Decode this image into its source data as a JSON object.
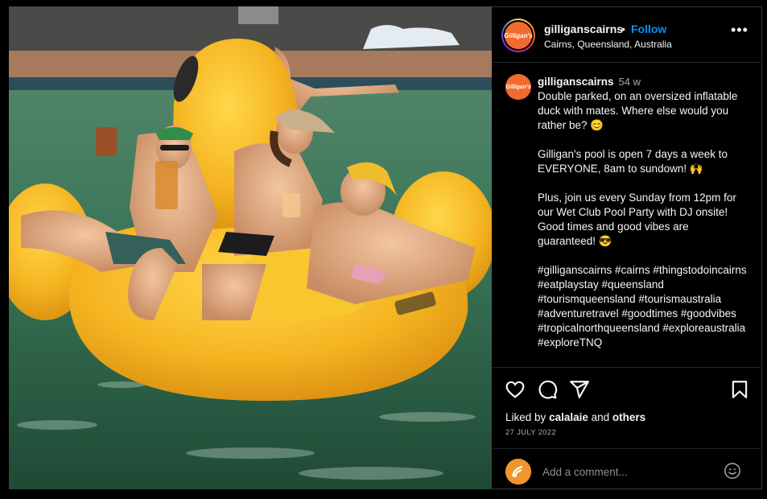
{
  "post": {
    "username": "gilliganscairns",
    "separator": "•",
    "follow_label": "Follow",
    "location": "Cairns, Queensland, Australia",
    "more_label": "•••",
    "avatar_text": "Gilligan's"
  },
  "caption": {
    "username": "gilliganscairns",
    "time_ago": "54 w",
    "text": "Double parked, on an oversized inflatable duck with mates. Where else would you rather be? 😊\n\nGilligan's pool is open 7 days a week to EVERYONE, 8am to sundown! 🙌\n\nPlus, join us every Sunday from 12pm for our Wet Club Pool Party with DJ onsite! Good times and good vibes are guaranteed! 😎\n\n#gilliganscairns #cairns #thingstodoincairns #eatplaystay #queensland #tourismqueensland #tourismaustralia #adventuretravel #goodtimes #goodvibes #tropicalnorthqueensland #exploreaustralia #exploreTNQ"
  },
  "actions": {
    "like_icon": "heart-icon",
    "comment_icon": "comment-icon",
    "share_icon": "paper-plane-icon",
    "save_icon": "bookmark-icon"
  },
  "likes": {
    "prefix": "Liked by",
    "user": "calalaie",
    "and": "and",
    "others": "others"
  },
  "date": "27 JULY 2022",
  "comment": {
    "placeholder": "Add a comment...",
    "emoji_icon": "smiley-icon"
  },
  "colors": {
    "accent": "#0095f6",
    "background": "#000000",
    "text": "#f5f5f5",
    "muted": "#a8a8a8",
    "duck_yellow": "#f7b924",
    "pool_green": "#3f7a5c"
  }
}
